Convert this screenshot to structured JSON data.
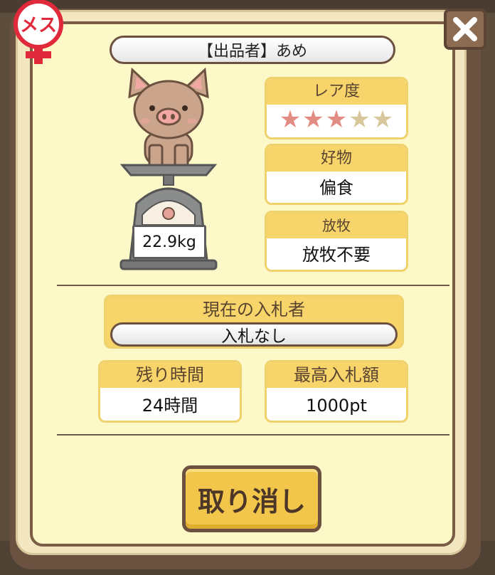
{
  "gender_badge": {
    "label": "メス",
    "color": "#e0293a"
  },
  "seller": {
    "text": "【出品者】あめ"
  },
  "weight": {
    "text": "22.9kg"
  },
  "rarity": {
    "heading": "レア度",
    "stars": 3,
    "max_stars": 5
  },
  "favorite": {
    "heading": "好物",
    "value": "偏食"
  },
  "grazing": {
    "heading": "放牧",
    "value": "放牧不要"
  },
  "bidder": {
    "heading": "現在の入札者",
    "value": "入札なし"
  },
  "time_left": {
    "heading": "残り時間",
    "value": "24時間"
  },
  "highest_bid": {
    "heading": "最高入札額",
    "value": "1000pt"
  },
  "cancel_button": {
    "label": "取り消し"
  },
  "icons": {
    "close": "close-icon",
    "pig": "pig-icon",
    "scale": "scale-icon",
    "gender": "female-icon"
  },
  "colors": {
    "accent": "#f7d56b",
    "star_on": "#e28d83",
    "star_off": "#d8c79a",
    "panel_bg": "#fdf8c8"
  }
}
